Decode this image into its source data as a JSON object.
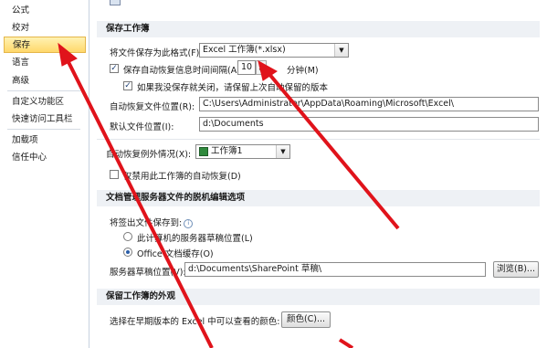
{
  "sidebar": {
    "items": [
      {
        "label": "公式"
      },
      {
        "label": "校对"
      },
      {
        "label": "保存"
      },
      {
        "label": "语言"
      },
      {
        "label": "高级"
      },
      {
        "label": "自定义功能区"
      },
      {
        "label": "快速访问工具栏"
      },
      {
        "label": "加载项"
      },
      {
        "label": "信任中心"
      }
    ],
    "active": "保存"
  },
  "save_workbook": {
    "section_title": "保存工作簿",
    "format_label": "将文件保存为此格式(F):",
    "format_value": "Excel 工作簿(*.xlsx)",
    "autorecover_label": "保存自动恢复信息时间间隔(A)",
    "autorecover_checked": true,
    "autorecover_value": "10",
    "minutes_label": "分钟(M)",
    "keep_last_label": "如果我没保存就关闭，请保留上次自动保留的版本",
    "keep_last_checked": true,
    "autorecover_location_label": "自动恢复文件位置(R):",
    "autorecover_location_value": "C:\\Users\\Administrator\\AppData\\Roaming\\Microsoft\\Excel\\",
    "default_location_label": "默认文件位置(I):",
    "default_location_value": "d:\\Documents"
  },
  "autorecover_exceptions": {
    "label": "自动恢复例外情况(X):",
    "workbook_value": "工作簿1",
    "disable_label": "仅禁用此工作簿的自动恢复(D)",
    "disable_checked": false
  },
  "offline_editing": {
    "section_title": "文档管理服务器文件的脱机编辑选项",
    "save_checked_out_label": "将签出文件保存到:",
    "option_server_drafts": "此计算机的服务器草稿位置(L)",
    "option_office_cache": "Office 文档缓存(O)",
    "selected": "option_office_cache",
    "server_drafts_label": "服务器草稿位置(V):",
    "server_drafts_value": "d:\\Documents\\SharePoint 草稿\\",
    "browse_label": "浏览(B)..."
  },
  "appearance": {
    "section_title": "保留工作簿的外观",
    "colors_label": "选择在早期版本的 Excel 中可以查看的颜色:",
    "colors_button": "颜色(C)..."
  },
  "colors": {
    "accent_active": "#ffd86b",
    "annotation_arrow": "#e0131b"
  }
}
